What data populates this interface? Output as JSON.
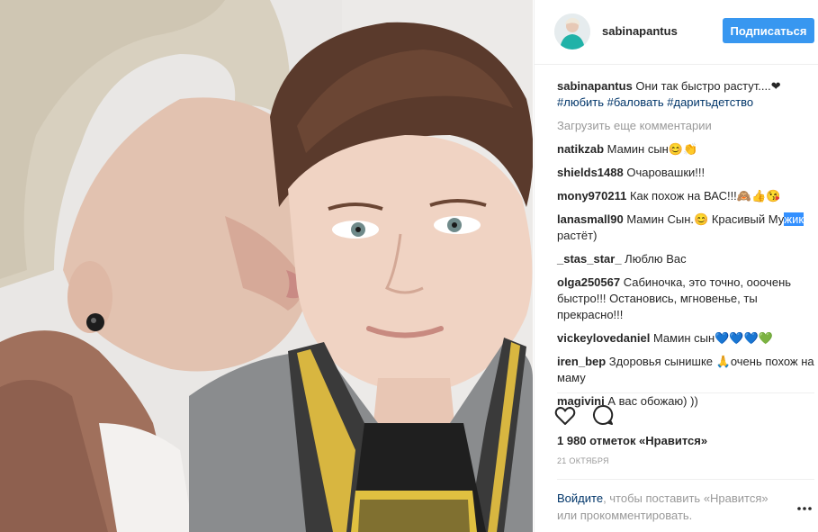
{
  "post": {
    "username": "sabinapantus",
    "follow_label": "Подписаться",
    "caption": {
      "username": "sabinapantus",
      "text": " Они так быстро растут....❤",
      "hashtags": [
        "#любить",
        "#баловать",
        "#даритьдетство"
      ]
    },
    "load_more": "Загрузить еще комментарии",
    "comments": [
      {
        "user": "natikzab",
        "text": " Мамин сын😊👏"
      },
      {
        "user": "shields1488",
        "text": " Очаровашки!!!"
      },
      {
        "user": "mony970211",
        "text": " Как похож на ВАС!!!🙈👍😘"
      },
      {
        "user": "lanasmall90",
        "text_before": " Мамин Сын.😊 Красивый Му",
        "text_selected": "жик",
        "text_after": " растёт)"
      },
      {
        "user": "_stas_star_",
        "text": " Люблю Вас"
      },
      {
        "user": "olga250567",
        "text": " Сабиночка, это точно, ооочень быстро!!! Остановись, мгновенье, ты прекрасно!!!"
      },
      {
        "user": "vickeylovedaniel",
        "text": " Мамин сын💙💙💙💚"
      },
      {
        "user": "iren_bep",
        "text": " Здоровья сынишке 🙏очень похож на маму"
      },
      {
        "user": "magivini",
        "text": " А вас обожаю) ))"
      }
    ],
    "likes": "1 980 отметок «Нравится»",
    "date": "21 ОКТЯБРЯ",
    "login_link": "Войдите",
    "login_text": ", чтобы поставить «Нравится» или прокомментировать.",
    "icons": {
      "like": "heart-icon",
      "comment": "comment-icon",
      "more": "more-icon"
    },
    "colors": {
      "follow": "#3897f0",
      "link": "#003569",
      "muted": "#999999",
      "selection": "#3390ff"
    }
  }
}
